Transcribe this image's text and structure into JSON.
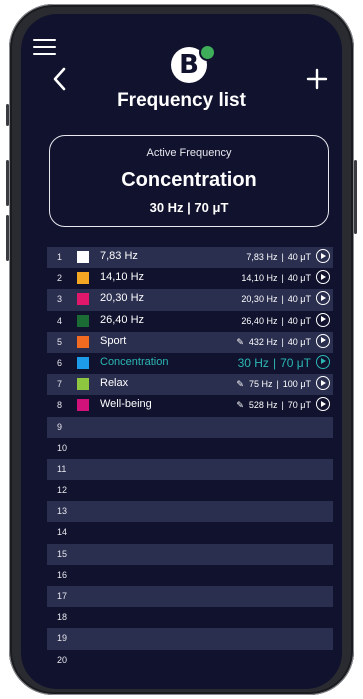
{
  "header": {
    "title": "Frequency list",
    "logo_letter": "B"
  },
  "active": {
    "label": "Active Frequency",
    "name": "Concentration",
    "values": "30 Hz | 70 μT"
  },
  "colors": {
    "background": "#10122e",
    "row_alt": "#2a2e4f",
    "accent": "#2bb7b3",
    "badge": "#3fae5a"
  },
  "rows": [
    {
      "num": "1",
      "name": "7,83 Hz",
      "color": "#ffffff",
      "hz": "7,83 Hz",
      "ut": "40 μT",
      "editable": false,
      "active": false
    },
    {
      "num": "2",
      "name": "14,10 Hz",
      "color": "#f5a623",
      "hz": "14,10 Hz",
      "ut": "40 μT",
      "editable": false,
      "active": false
    },
    {
      "num": "3",
      "name": "20,30 Hz",
      "color": "#e0176b",
      "hz": "20,30 Hz",
      "ut": "40 μT",
      "editable": false,
      "active": false
    },
    {
      "num": "4",
      "name": "26,40 Hz",
      "color": "#1b6b35",
      "hz": "26,40 Hz",
      "ut": "40 μT",
      "editable": false,
      "active": false
    },
    {
      "num": "5",
      "name": "Sport",
      "color": "#f26b21",
      "hz": "432 Hz",
      "ut": "40 μT",
      "editable": true,
      "active": false
    },
    {
      "num": "6",
      "name": "Concentration",
      "color": "#1e9be8",
      "hz": "30 Hz",
      "ut": "70 μT",
      "editable": false,
      "active": true
    },
    {
      "num": "7",
      "name": "Relax",
      "color": "#8dc63f",
      "hz": "75 Hz",
      "ut": "100 μT",
      "editable": true,
      "active": false
    },
    {
      "num": "8",
      "name": "Well-being",
      "color": "#d1127a",
      "hz": "528 Hz",
      "ut": "70 μT",
      "editable": true,
      "active": false
    },
    {
      "num": "9"
    },
    {
      "num": "10"
    },
    {
      "num": "11"
    },
    {
      "num": "12"
    },
    {
      "num": "13"
    },
    {
      "num": "14"
    },
    {
      "num": "15"
    },
    {
      "num": "16"
    },
    {
      "num": "17"
    },
    {
      "num": "18"
    },
    {
      "num": "19"
    },
    {
      "num": "20"
    }
  ]
}
